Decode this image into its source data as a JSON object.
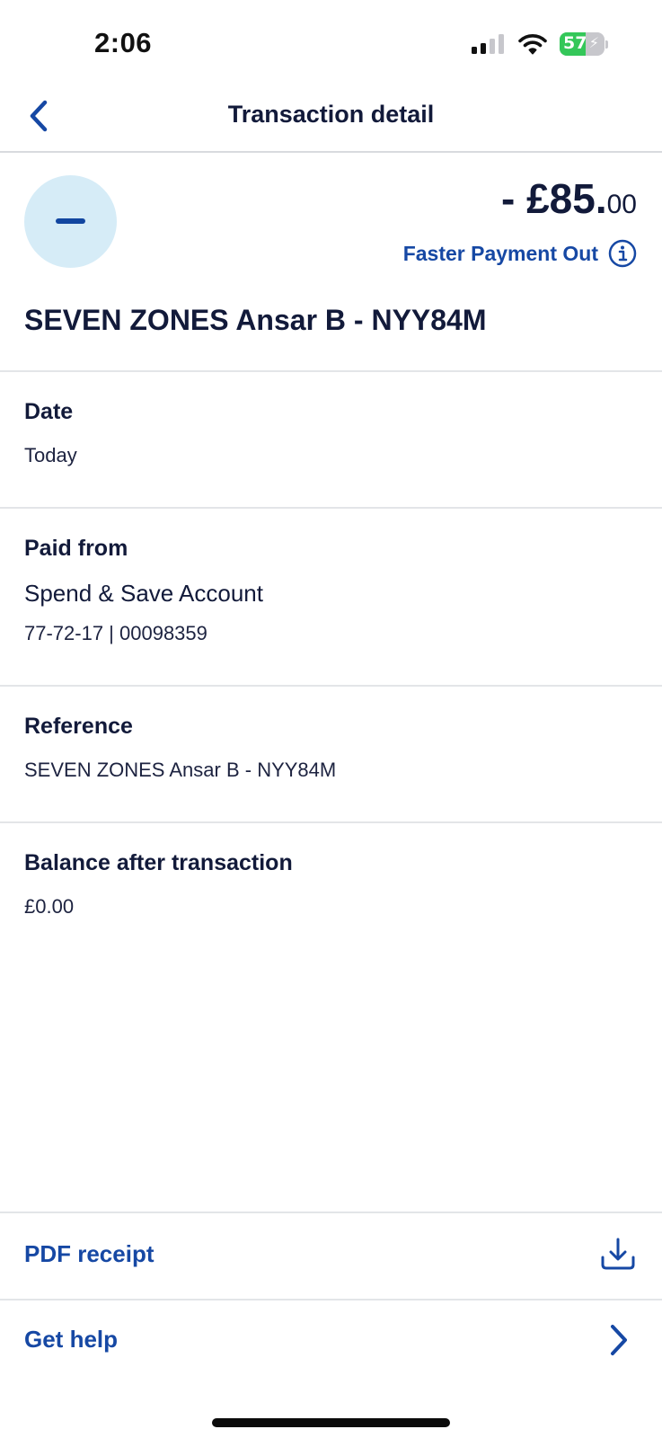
{
  "status_bar": {
    "time": "2:06",
    "battery_percent": 57,
    "battery_text": "57",
    "battery_charging": true
  },
  "header": {
    "title": "Transaction detail",
    "back_icon": "chevron-left-icon"
  },
  "transaction": {
    "icon": "minus-icon",
    "amount_main": "- £85.",
    "amount_pence": "00",
    "payment_type": "Faster Payment Out",
    "info_icon": "info-icon",
    "payee": "SEVEN ZONES Ansar B - NYY84M"
  },
  "date": {
    "label": "Date",
    "value": "Today"
  },
  "paid_from": {
    "label": "Paid from",
    "account_name": "Spend & Save Account",
    "account_details": "77-72-17 | 00098359"
  },
  "reference": {
    "label": "Reference",
    "value": "SEVEN ZONES Ansar B - NYY84M"
  },
  "balance": {
    "label": "Balance after transaction",
    "value": "£0.00"
  },
  "actions": {
    "pdf_receipt_label": "PDF receipt",
    "pdf_receipt_icon": "download-icon",
    "get_help_label": "Get help",
    "get_help_icon": "chevron-right-icon"
  },
  "colors": {
    "accent": "#1648a4",
    "text": "#121a3a",
    "icon_circle": "#d6ecf7",
    "battery_green": "#34c759"
  }
}
